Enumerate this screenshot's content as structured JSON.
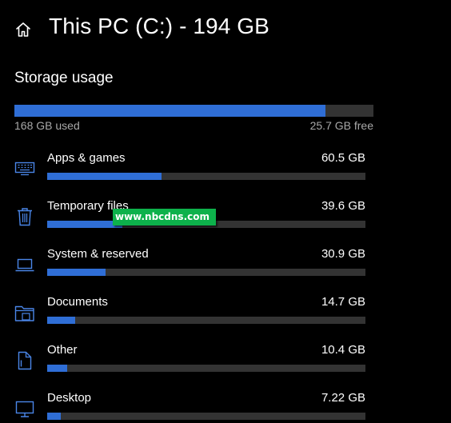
{
  "header": {
    "title": "This PC (C:) - 194 GB",
    "home_icon": "home-icon"
  },
  "storage": {
    "section_title": "Storage usage",
    "used_label": "168 GB used",
    "free_label": "25.7 GB free",
    "used_fraction": 0.867
  },
  "categories": [
    {
      "name": "Apps & games",
      "size": "60.5 GB",
      "icon": "keyboard-icon",
      "fraction": 0.36
    },
    {
      "name": "Temporary files",
      "size": "39.6 GB",
      "icon": "trash-icon",
      "fraction": 0.235
    },
    {
      "name": "System & reserved",
      "size": "30.9 GB",
      "icon": "laptop-icon",
      "fraction": 0.184
    },
    {
      "name": "Documents",
      "size": "14.7 GB",
      "icon": "folder-icon",
      "fraction": 0.088
    },
    {
      "name": "Other",
      "size": "10.4 GB",
      "icon": "file-icon",
      "fraction": 0.062
    },
    {
      "name": "Desktop",
      "size": "7.22 GB",
      "icon": "monitor-icon",
      "fraction": 0.043
    }
  ],
  "watermark": {
    "text": "www.nbcdns.com"
  },
  "colors": {
    "accent": "#2f6ed6",
    "track": "#333333",
    "background": "#000000",
    "icon": "#4a86e8",
    "watermark": "#0db14b"
  }
}
